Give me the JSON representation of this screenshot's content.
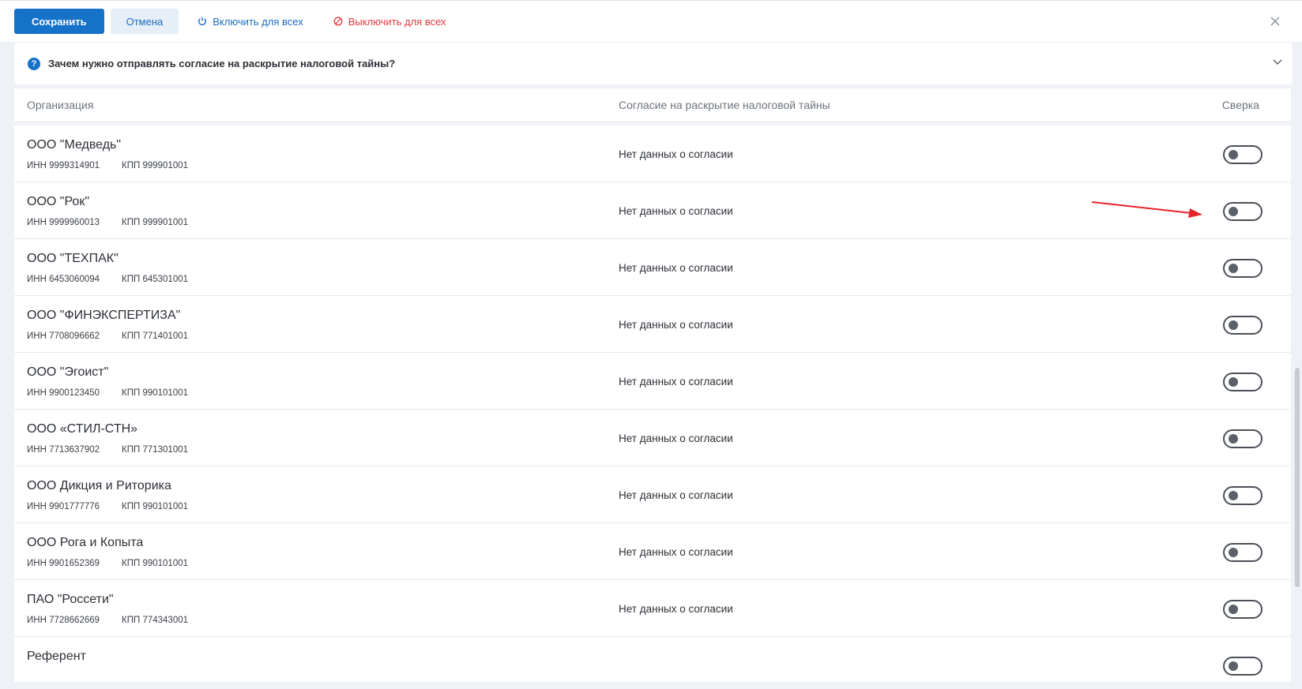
{
  "toolbar": {
    "save_label": "Сохранить",
    "cancel_label": "Отмена",
    "enable_all_label": "Включить для всех",
    "disable_all_label": "Выключить для всех"
  },
  "info": {
    "question": "Зачем нужно отправлять согласие на раскрытие налоговой тайны?"
  },
  "table": {
    "headers": {
      "organization": "Организация",
      "consent": "Согласие на раскрытие налоговой тайны",
      "reconciliation": "Сверка"
    },
    "rows": [
      {
        "name": "ООО \"Медведь\"",
        "inn": "ИНН 9999314901",
        "kpp": "КПП 999901001",
        "consent": "Нет данных о согласии"
      },
      {
        "name": "ООО \"Рок\"",
        "inn": "ИНН 9999960013",
        "kpp": "КПП 999901001",
        "consent": "Нет данных о согласии"
      },
      {
        "name": "ООО \"ТЕХПАК\"",
        "inn": "ИНН 6453060094",
        "kpp": "КПП 645301001",
        "consent": "Нет данных о согласии"
      },
      {
        "name": "ООО \"ФИНЭКСПЕРТИЗА\"",
        "inn": "ИНН 7708096662",
        "kpp": "КПП 771401001",
        "consent": "Нет данных о согласии"
      },
      {
        "name": "ООО \"Эгоист\"",
        "inn": "ИНН 9900123450",
        "kpp": "КПП 990101001",
        "consent": "Нет данных о согласии"
      },
      {
        "name": "ООО «СТИЛ-СТН»",
        "inn": "ИНН 7713637902",
        "kpp": "КПП 771301001",
        "consent": "Нет данных о согласии"
      },
      {
        "name": "ООО Дикция и Риторика",
        "inn": "ИНН 9901777776",
        "kpp": "КПП 990101001",
        "consent": "Нет данных о согласии"
      },
      {
        "name": "ООО Рога и Копыта",
        "inn": "ИНН 9901652369",
        "kpp": "КПП 990101001",
        "consent": "Нет данных о согласии"
      },
      {
        "name": "ПАО \"Россети\"",
        "inn": "ИНН 7728662669",
        "kpp": "КПП 774343001",
        "consent": "Нет данных о согласии"
      },
      {
        "name": "Референт",
        "inn": "",
        "kpp": "",
        "consent": ""
      }
    ]
  },
  "colors": {
    "primary": "#1472c9",
    "danger": "#e0393e",
    "annotation": "#e8232a"
  }
}
